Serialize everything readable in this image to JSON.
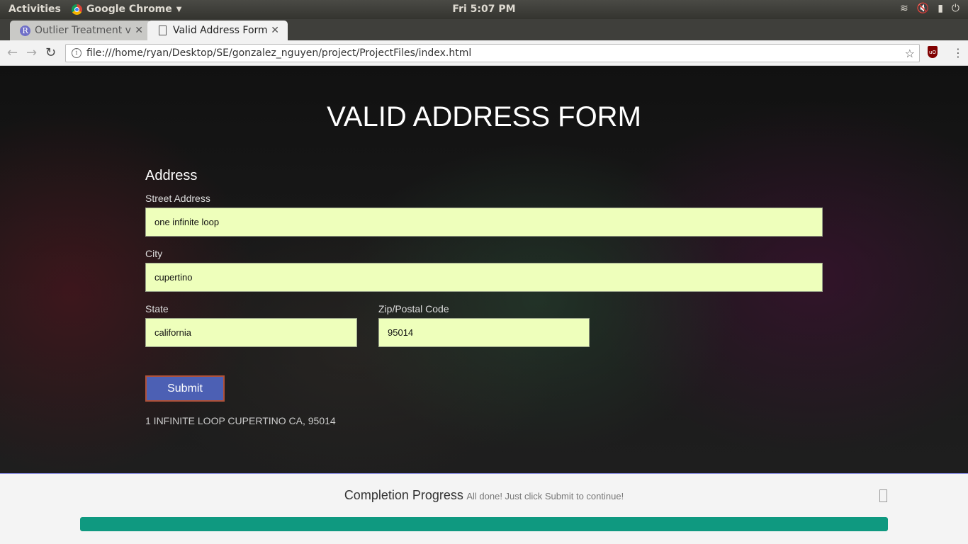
{
  "os_bar": {
    "activities": "Activities",
    "app_name": "Google Chrome",
    "clock": "Fri  5:07 PM"
  },
  "browser": {
    "tabs": [
      {
        "title": "Outlier Treatment v",
        "favicon": "r-logo-icon",
        "active": false
      },
      {
        "title": "Valid Address Form",
        "favicon": "document-icon",
        "active": true
      }
    ],
    "url": "file:///home/ryan/Desktop/SE/gonzalez_nguyen/project/ProjectFiles/index.html"
  },
  "form": {
    "title": "VALID ADDRESS FORM",
    "section": "Address",
    "street_label": "Street Address",
    "street_value": "one infinite loop",
    "city_label": "City",
    "city_value": "cupertino",
    "state_label": "State",
    "state_value": "california",
    "zip_label": "Zip/Postal Code",
    "zip_value": "95014",
    "submit_label": "Submit",
    "result": "1 INFINITE LOOP CUPERTINO CA, 95014"
  },
  "progress": {
    "title": "Completion Progress",
    "message": "All done! Just click Submit to continue!",
    "percent": 100,
    "bar_color": "#0f9980"
  },
  "colors": {
    "input_bg": "#eeffbb",
    "submit_bg": "#4c60b4"
  }
}
